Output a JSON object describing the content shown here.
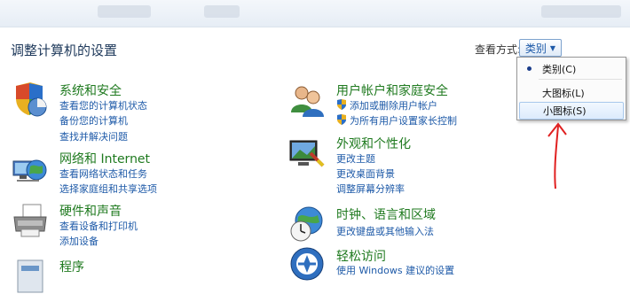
{
  "page_title": "调整计算机的设置",
  "view": {
    "label": "查看方式:",
    "selected": "类别"
  },
  "menu": {
    "items": [
      "类别(C)",
      "大图标(L)",
      "小图标(S)"
    ],
    "checked_index": 0,
    "highlighted_index": 2
  },
  "categories": [
    {
      "title": "系统和安全",
      "icon": "shield-computer-icon",
      "links": [
        "查看您的计算机状态",
        "备份您的计算机",
        "查找并解决问题"
      ]
    },
    {
      "title": "网络和 Internet",
      "icon": "network-globe-icon",
      "links": [
        "查看网络状态和任务",
        "选择家庭组和共享选项"
      ]
    },
    {
      "title": "硬件和声音",
      "icon": "printer-icon",
      "links": [
        "查看设备和打印机",
        "添加设备"
      ]
    },
    {
      "title": "程序",
      "icon": "programs-icon",
      "links": []
    },
    {
      "title": "用户帐户和家庭安全",
      "icon": "users-icon",
      "links": [
        "添加或删除用户帐户",
        "为所有用户设置家长控制"
      ]
    },
    {
      "title": "外观和个性化",
      "icon": "appearance-icon",
      "links": [
        "更改主题",
        "更改桌面背景",
        "调整屏幕分辨率"
      ]
    },
    {
      "title": "时钟、语言和区域",
      "icon": "clock-globe-icon",
      "links": [
        "更改键盘或其他输入法"
      ]
    },
    {
      "title": "轻松访问",
      "icon": "ease-of-access-icon",
      "links": [
        "使用 Windows 建议的设置"
      ]
    }
  ],
  "colors": {
    "title_green": "#1f7a1f",
    "link_blue": "#1e5aa8",
    "annotation_red": "#e02020"
  }
}
